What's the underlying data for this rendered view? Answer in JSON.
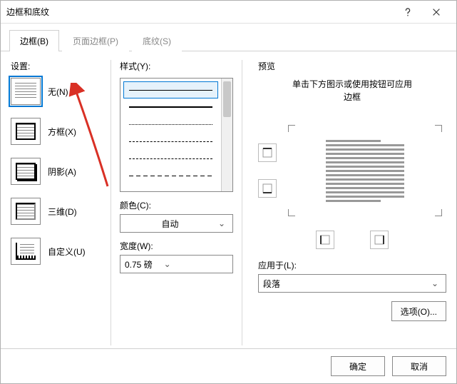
{
  "titlebar": {
    "title": "边框和底纹"
  },
  "tabs": {
    "border": "边框(B)",
    "page_border": "页面边框(P)",
    "shading": "底纹(S)",
    "active": "border"
  },
  "settings": {
    "label": "设置:",
    "items": [
      {
        "key": "none",
        "label": "无(N)",
        "selected": true
      },
      {
        "key": "box",
        "label": "方框(X)",
        "selected": false
      },
      {
        "key": "shadow",
        "label": "阴影(A)",
        "selected": false
      },
      {
        "key": "3d",
        "label": "三维(D)",
        "selected": false
      },
      {
        "key": "custom",
        "label": "自定义(U)",
        "selected": false
      }
    ]
  },
  "style": {
    "label": "样式(Y):",
    "color_label": "颜色(C):",
    "color_value": "自动",
    "width_label": "宽度(W):",
    "width_value": "0.75 磅"
  },
  "preview": {
    "label": "预览",
    "hint_line1": "单击下方图示或使用按钮可应用",
    "hint_line2": "边框",
    "apply_label": "应用于(L):",
    "apply_value": "段落",
    "options_btn": "选项(O)..."
  },
  "footer": {
    "ok": "确定",
    "cancel": "取消"
  }
}
